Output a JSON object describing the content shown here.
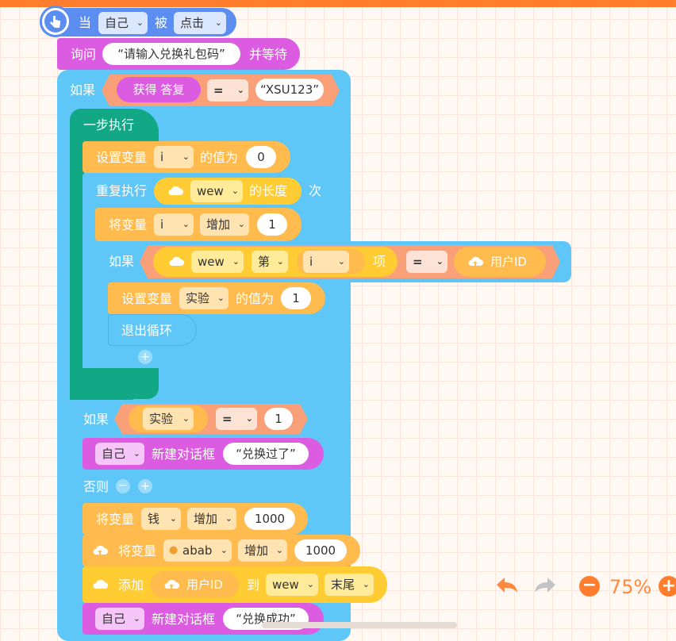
{
  "colors": {
    "accent": "#ff7e2d",
    "event": "#5b8ef0",
    "sensing": "#db5ce0",
    "control": "#5fc7f7",
    "step": "#12a886",
    "variable": "#ffbb4d",
    "data": "#ffcc33",
    "operator": "#f9a079"
  },
  "event": {
    "when": "当",
    "target": "自己",
    "is": "被",
    "action": "点击"
  },
  "ask": {
    "label": "询问",
    "question": "“请输入兑换礼包码”",
    "suffix": "并等待"
  },
  "if1": {
    "label": "如果",
    "answer": "获得 答复",
    "op": "=",
    "value": "“XSU123”"
  },
  "step": {
    "label": "一步执行"
  },
  "setvar1": {
    "label": "设置变量",
    "var": "i",
    "mid": "的值为",
    "value": "0"
  },
  "repeat": {
    "label": "重复执行",
    "list": "wew",
    "len": "的长度",
    "suffix": "次"
  },
  "change1": {
    "label": "将变量",
    "var": "i",
    "action": "增加",
    "value": "1"
  },
  "if2": {
    "label": "如果",
    "list": "wew",
    "nth": "第",
    "index": "i",
    "item": "项",
    "op": "=",
    "right": "用户ID"
  },
  "setvar2": {
    "label": "设置变量",
    "var": "实验",
    "mid": "的值为",
    "value": "1"
  },
  "exitloop": {
    "label": "退出循环"
  },
  "if3": {
    "label": "如果",
    "var": "实验",
    "op": "=",
    "value": "1"
  },
  "dialog1": {
    "target": "自己",
    "label": "新建对话框",
    "text": "“兑换过了”"
  },
  "else": {
    "label": "否则"
  },
  "change2": {
    "label": "将变量",
    "var": "钱",
    "action": "增加",
    "value": "1000"
  },
  "change3": {
    "label": "将变量",
    "var": "abab",
    "action": "增加",
    "value": "1000"
  },
  "addlist": {
    "label": "添加",
    "item": "用户ID",
    "to": "到",
    "list": "wew",
    "pos": "末尾"
  },
  "dialog2": {
    "target": "自己",
    "label": "新建对话框",
    "text": "“兑换成功”"
  },
  "zoom": {
    "value": "75%"
  }
}
